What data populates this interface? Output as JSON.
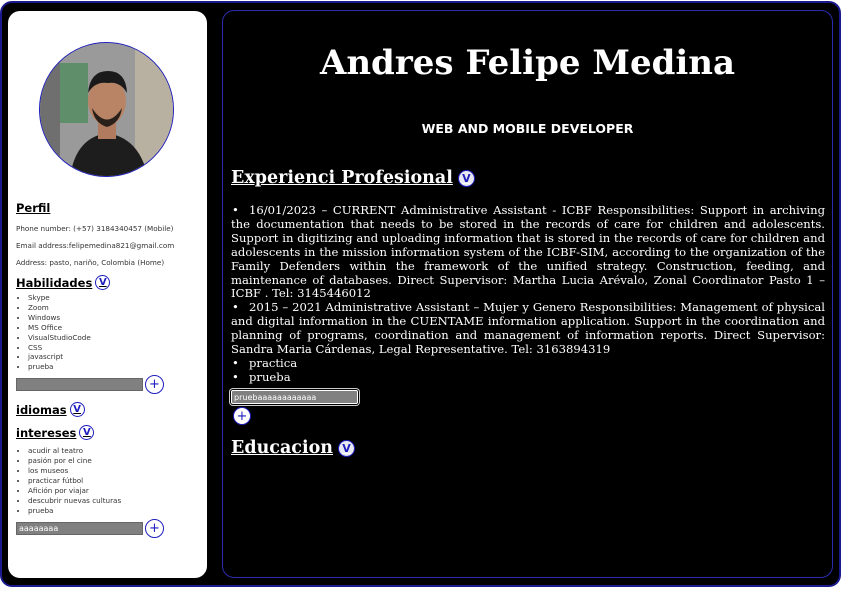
{
  "profile": {
    "name": "Andres Felipe Medina",
    "role": "WEB AND MOBILE DEVELOPER"
  },
  "sidebar": {
    "perfil_title": "Perfil",
    "phone": "Phone number: (+57) 3184340457 (Mobile)",
    "email": "Email address:felipemedina821@gmail.com",
    "address": "Address: pasto, nariño, Colombia (Home)",
    "habilidades_title": "Habilidades",
    "habilidades": [
      "Skype",
      "Zoom",
      "Windows",
      "MS Office",
      "VisualStudioCode",
      "CSS",
      "javascript",
      "prueba"
    ],
    "habilidades_input_value": "",
    "idiomas_title": "idiomas",
    "intereses_title": "intereses",
    "intereses": [
      "acudir al teatro",
      "pasión por el cine",
      "los museos",
      "practicar fútbol",
      "Afición por viajar",
      "descubrir nuevas culturas",
      "prueba"
    ],
    "intereses_input_value": "aaaaaaaa",
    "toggle_label": "V",
    "add_label": "+"
  },
  "main": {
    "experience_title": "Experienci Profesional",
    "experience": [
      "16/01/2023 – CURRENT Administrative Assistant - ICBF Responsibilities: Support in archiving the documentation that needs to be stored in the records of care for children and adolescents. Support in digitizing and uploading information that is stored in the records of care for children and adolescents in the mission information system of the ICBF-SIM, according to the organization of the Family Defenders within the framework of the unified strategy. Construction, feeding, and maintenance of databases. Direct Supervisor: Martha Lucia Arévalo, Zonal Coordinator Pasto 1 – ICBF . Tel: 3145446012",
      "2015 – 2021 Administrative Assistant – Mujer y Genero Responsibilities: Management of physical and digital information in the CUENTAME information application. Support in the coordination and planning of programs, coordination and management of information reports. Direct Supervisor: Sandra Maria Cárdenas, Legal Representative. Tel: 3163894319",
      "practica",
      "prueba"
    ],
    "experience_input_value": "pruebaaaaaaaaaaaa",
    "education_title": "Educacion",
    "toggle_label": "V",
    "add_label": "+"
  },
  "colors": {
    "frame_border": "#1a1a8e",
    "accent": "#1e1ebe",
    "background": "#000000",
    "sidebar_bg": "#ffffff"
  }
}
